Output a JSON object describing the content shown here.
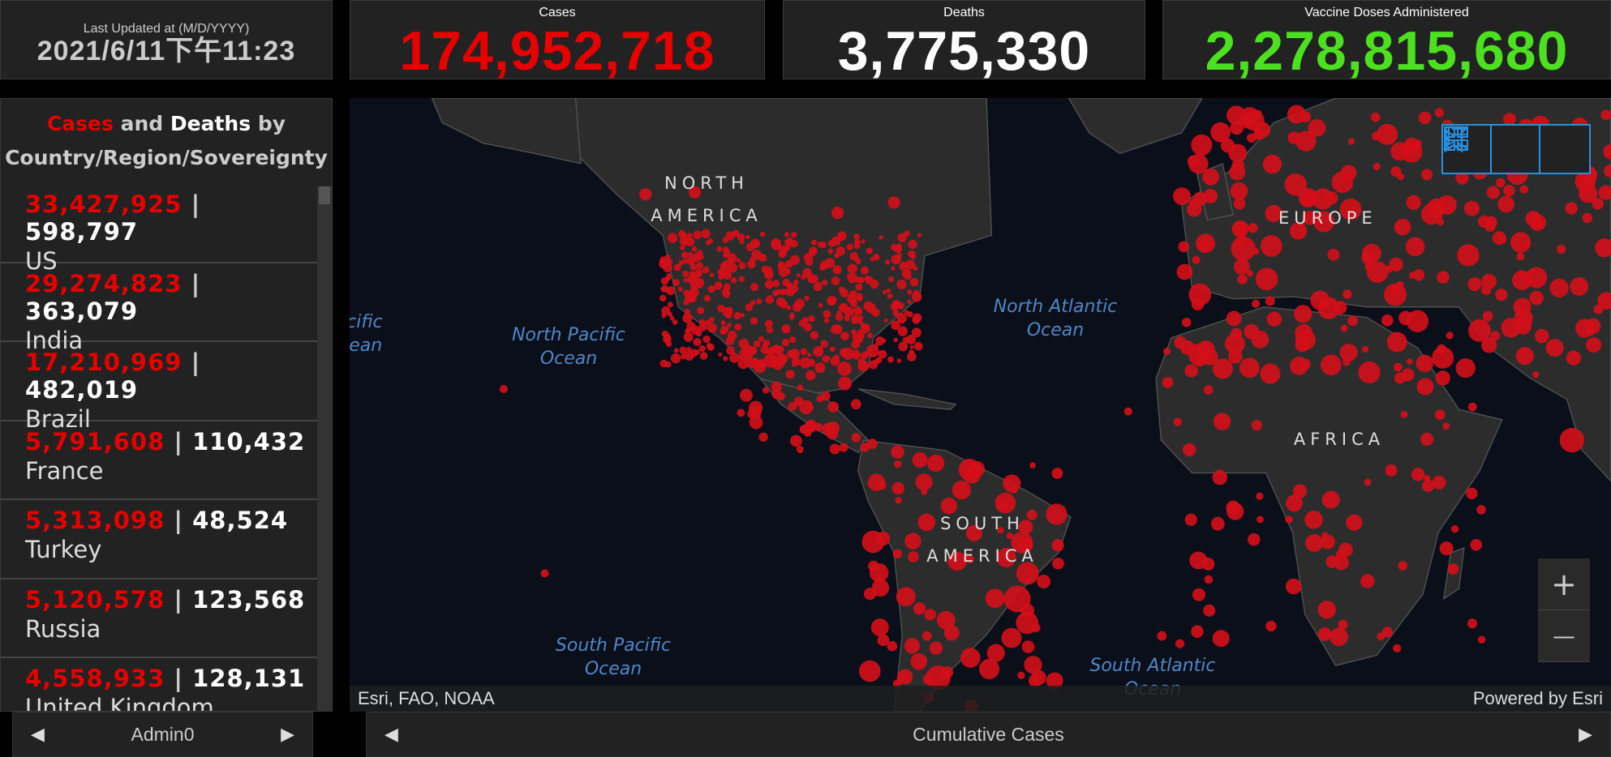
{
  "header": {
    "last_updated_label": "Last Updated at (M/D/YYYY)",
    "last_updated_value": "2021/6/11下午11:23",
    "cases_label": "Cases",
    "cases_value": "174,952,718",
    "deaths_label": "Deaths",
    "deaths_value": "3,775,330",
    "vaccine_label": "Vaccine Doses Administered",
    "vaccine_value": "2,278,815,680"
  },
  "colors": {
    "cases": "#e60000",
    "deaths": "#ffffff",
    "vaccine": "#4ce020",
    "widget_accent": "#2b8fe0"
  },
  "list": {
    "title_cases": "Cases",
    "title_and": "and",
    "title_deaths": "Deaths",
    "title_by": "by",
    "title_line2": "Country/Region/Sovereignty",
    "rows": [
      {
        "cases": "33,427,925",
        "deaths": "598,797",
        "name": "US"
      },
      {
        "cases": "29,274,823",
        "deaths": "363,079",
        "name": "India"
      },
      {
        "cases": "17,210,969",
        "deaths": "482,019",
        "name": "Brazil"
      },
      {
        "cases": "5,791,608",
        "deaths": "110,432",
        "name": "France"
      },
      {
        "cases": "5,313,098",
        "deaths": "48,524",
        "name": "Turkey"
      },
      {
        "cases": "5,120,578",
        "deaths": "123,568",
        "name": "Russia"
      },
      {
        "cases": "4,558,933",
        "deaths": "128,131",
        "name": "United Kingdom"
      }
    ],
    "separator": "|",
    "footer_label": "Admin0"
  },
  "map": {
    "continents": {
      "na": "NORTH AMERICA",
      "sa": "SOUTH AMERICA",
      "eu": "EUROPE",
      "af": "AFRICA"
    },
    "oceans": {
      "npac": "North Pacific Ocean",
      "natl": "North Atlantic Ocean",
      "spac": "South Pacific Ocean",
      "satl": "South Atlantic Ocean",
      "pac_left": "Pacific Ocean"
    },
    "attribution": "Esri, FAO, NOAA",
    "powered": "Powered by Esri",
    "zoom_in": "+",
    "zoom_out": "—",
    "icons": [
      "bookmark-icon",
      "legend-list-icon",
      "basemap-gallery-icon"
    ]
  },
  "map_footer": {
    "label": "Cumulative Cases"
  }
}
